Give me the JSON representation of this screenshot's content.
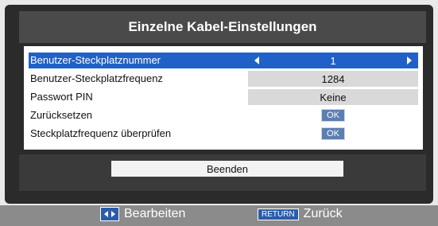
{
  "title": "Einzelne Kabel-Einstellungen",
  "rows": [
    {
      "label": "Benutzer-Steckplatznummer",
      "value": "1"
    },
    {
      "label": "Benutzer-Steckplatzfrequenz",
      "value": "1284"
    },
    {
      "label": "Passwort PIN",
      "value": "Keine"
    },
    {
      "label": "Zurücksetzen",
      "value": "OK"
    },
    {
      "label": "Steckplatzfrequenz überprüfen",
      "value": "OK"
    }
  ],
  "exit_label": "Beenden",
  "footer": {
    "edit_label": "Bearbeiten",
    "return_key": "RETURN",
    "back_label": "Zurück"
  },
  "colors": {
    "selected": "#1f61c8",
    "button": "#5b7fb1",
    "footer": "#8b8b8b"
  }
}
